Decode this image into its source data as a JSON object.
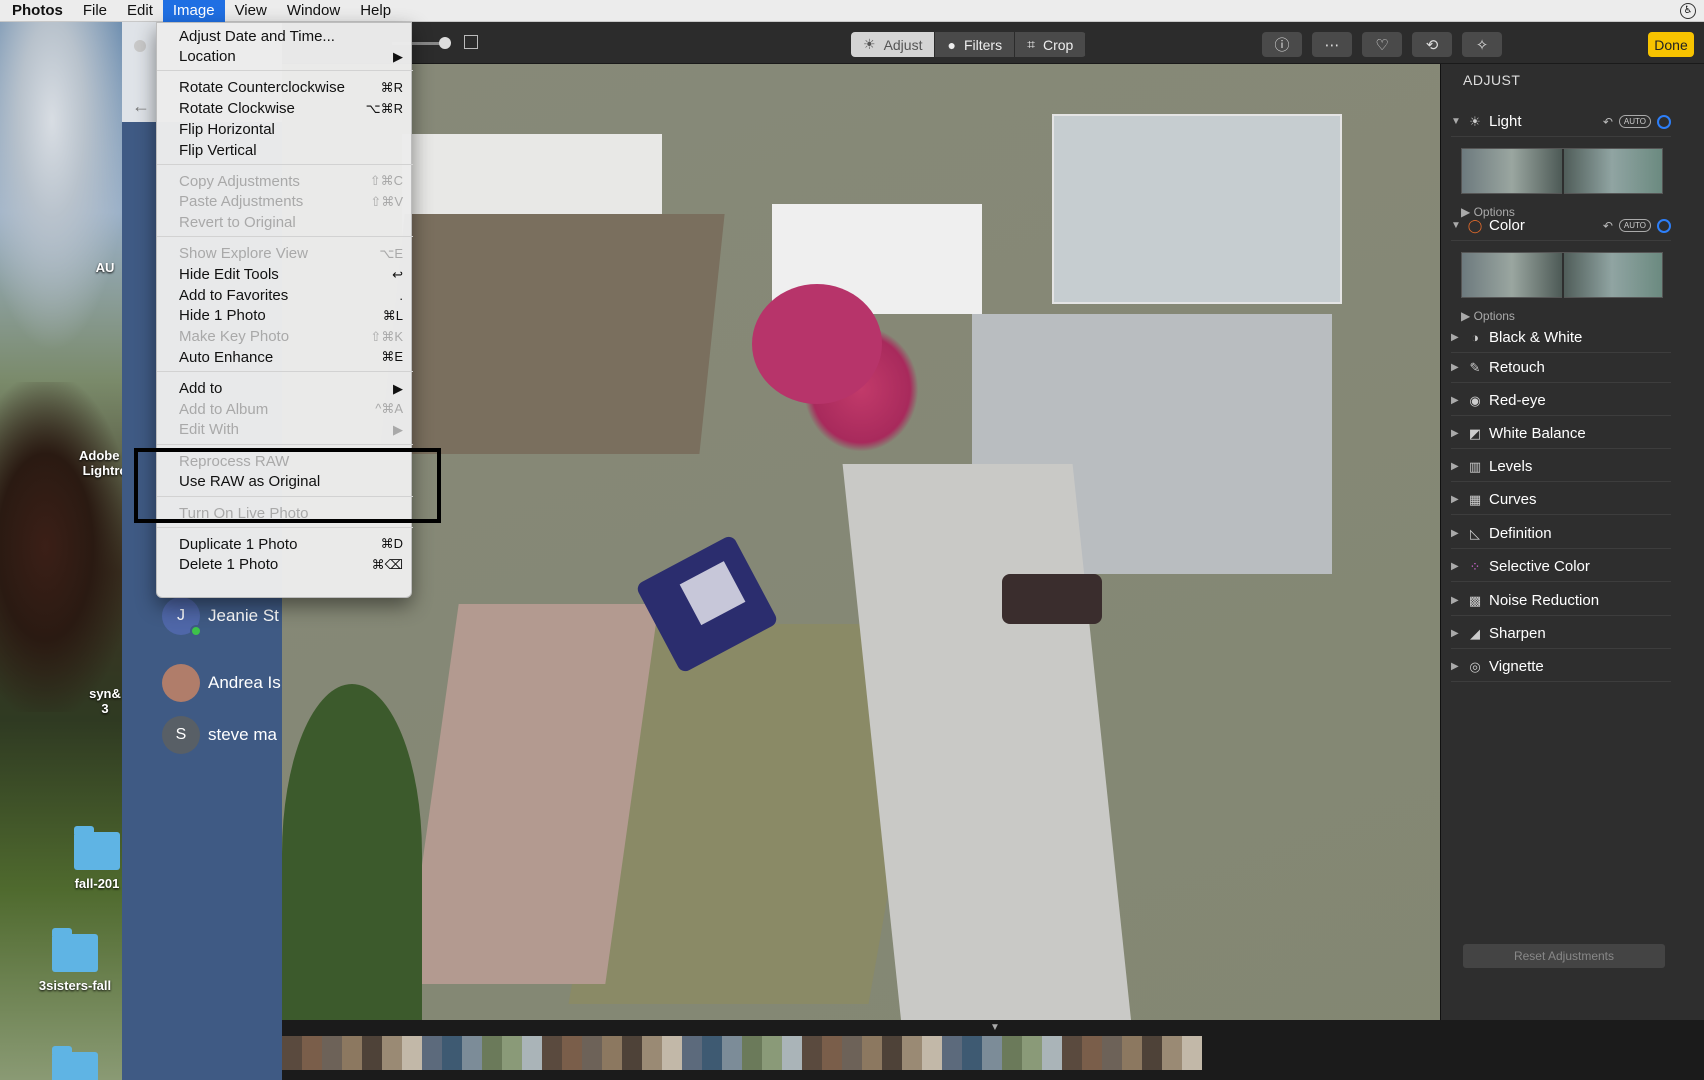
{
  "menubar": {
    "app": "Photos",
    "items": [
      "File",
      "Edit",
      "Image",
      "View",
      "Window",
      "Help"
    ],
    "active": "Image"
  },
  "desktop": {
    "items": [
      {
        "label": "AU"
      },
      {
        "label": "Adobe L"
      },
      {
        "label": "Lightro"
      },
      {
        "label": "syn&"
      },
      {
        "label": "3"
      },
      {
        "label": "fall-201"
      },
      {
        "label": "3sisters-fall"
      }
    ]
  },
  "messages": {
    "contacts": [
      {
        "initial": "J",
        "name": "Jeanie St",
        "color": "#4f67a8"
      },
      {
        "initial": "",
        "name": "Andrea Is",
        "color": "#b07d6a"
      },
      {
        "initial": "S",
        "name": "steve ma",
        "color": "#585f66"
      }
    ]
  },
  "toolbar": {
    "tabs": [
      {
        "label": "Adjust",
        "icon": "sun-icon"
      },
      {
        "label": "Filters",
        "icon": "circles-icon"
      },
      {
        "label": "Crop",
        "icon": "crop-icon"
      }
    ],
    "active_tab": "Adjust",
    "buttons": [
      {
        "name": "info-button",
        "glyph": "ⓘ"
      },
      {
        "name": "more-button",
        "glyph": "⋯"
      },
      {
        "name": "favorite-button",
        "glyph": "♡"
      },
      {
        "name": "rotate-button",
        "glyph": "⟲"
      },
      {
        "name": "enhance-button",
        "glyph": "✧"
      }
    ],
    "done": "Done"
  },
  "image_menu": {
    "groups": [
      [
        {
          "label": "Adjust Date and Time...",
          "shortcut": "",
          "disabled": false
        },
        {
          "label": "Location",
          "shortcut": "▶",
          "disabled": false
        }
      ],
      [
        {
          "label": "Rotate Counterclockwise",
          "shortcut": "⌘R",
          "disabled": false
        },
        {
          "label": "Rotate Clockwise",
          "shortcut": "⌥⌘R",
          "disabled": false
        },
        {
          "label": "Flip Horizontal",
          "shortcut": "",
          "disabled": false
        },
        {
          "label": "Flip Vertical",
          "shortcut": "",
          "disabled": false
        }
      ],
      [
        {
          "label": "Copy Adjustments",
          "shortcut": "⇧⌘C",
          "disabled": true
        },
        {
          "label": "Paste Adjustments",
          "shortcut": "⇧⌘V",
          "disabled": true
        },
        {
          "label": "Revert to Original",
          "shortcut": "",
          "disabled": true
        }
      ],
      [
        {
          "label": "Show Explore View",
          "shortcut": "⌥E",
          "disabled": true
        },
        {
          "label": "Hide Edit Tools",
          "shortcut": "↩",
          "disabled": false
        },
        {
          "label": "Add to Favorites",
          "shortcut": ".",
          "disabled": false
        },
        {
          "label": "Hide 1 Photo",
          "shortcut": "⌘L",
          "disabled": false
        },
        {
          "label": "Make Key Photo",
          "shortcut": "⇧⌘K",
          "disabled": true
        },
        {
          "label": "Auto Enhance",
          "shortcut": "⌘E",
          "disabled": false
        }
      ],
      [
        {
          "label": "Add to",
          "shortcut": "▶",
          "disabled": false
        },
        {
          "label": "Add to Album",
          "shortcut": "^⌘A",
          "disabled": true
        },
        {
          "label": "Edit With",
          "shortcut": "▶",
          "disabled": true
        }
      ],
      [
        {
          "label": "Reprocess RAW",
          "shortcut": "",
          "disabled": true
        },
        {
          "label": "Use RAW as Original",
          "shortcut": "",
          "disabled": false
        }
      ],
      [
        {
          "label": "Turn On Live Photo",
          "shortcut": "",
          "disabled": true
        }
      ],
      [
        {
          "label": "Duplicate 1 Photo",
          "shortcut": "⌘D",
          "disabled": false
        },
        {
          "label": "Delete 1 Photo",
          "shortcut": "⌘⌫",
          "disabled": false
        }
      ]
    ]
  },
  "adjust_panel": {
    "title": "ADJUST",
    "auto_label": "AUTO",
    "options_label": "Options",
    "sections": [
      {
        "label": "Light",
        "icon": "sun-icon",
        "glyph": "☀",
        "expanded": true
      },
      {
        "label": "Color",
        "icon": "color-circle-icon",
        "glyph": "◯",
        "expanded": true
      },
      {
        "label": "Black & White",
        "icon": "half-circle-icon",
        "glyph": "◑",
        "expanded": false
      },
      {
        "label": "Retouch",
        "icon": "bandage-icon",
        "glyph": "✎",
        "expanded": false
      },
      {
        "label": "Red-eye",
        "icon": "eye-icon",
        "glyph": "◉",
        "expanded": false
      },
      {
        "label": "White Balance",
        "icon": "white-balance-icon",
        "glyph": "◩",
        "expanded": false
      },
      {
        "label": "Levels",
        "icon": "levels-icon",
        "glyph": "▥",
        "expanded": false
      },
      {
        "label": "Curves",
        "icon": "curves-icon",
        "glyph": "▦",
        "expanded": false
      },
      {
        "label": "Definition",
        "icon": "triangle-icon",
        "glyph": "◺",
        "expanded": false
      },
      {
        "label": "Selective Color",
        "icon": "dots-icon",
        "glyph": "⁘",
        "expanded": false
      },
      {
        "label": "Noise Reduction",
        "icon": "noise-icon",
        "glyph": "▩",
        "expanded": false
      },
      {
        "label": "Sharpen",
        "icon": "sharpen-icon",
        "glyph": "◢",
        "expanded": false
      },
      {
        "label": "Vignette",
        "icon": "vignette-icon",
        "glyph": "◎",
        "expanded": false
      }
    ],
    "reset": "Reset Adjustments"
  },
  "colors": {
    "menu_highlight": "#1f6fe3",
    "done": "#f7c300",
    "ring": "#2d7ff9"
  }
}
